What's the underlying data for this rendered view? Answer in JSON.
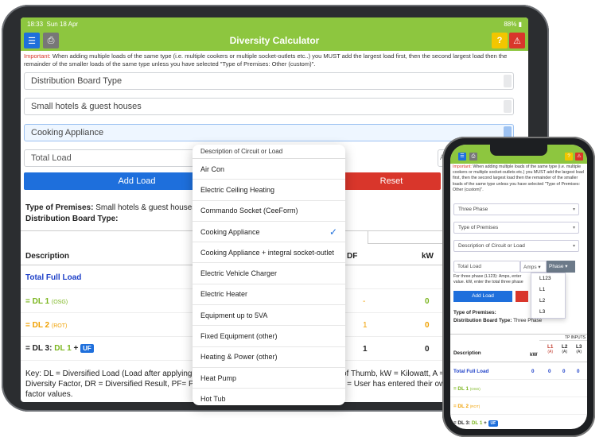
{
  "tablet": {
    "status": {
      "time": "18:33",
      "date": "Sun 18 Apr",
      "battery": "88%"
    },
    "header": {
      "title": "Diversity Calculator"
    },
    "notice": {
      "label": "Important:",
      "text": "When adding multiple loads of the same type (i.e. multiple cookers or multiple socket-outlets etc..) you MUST add the largest load first, then the second largest load then the remainder of the smaller loads of the same type unless you have selected \"Type of Premises: Other (custom)\"."
    },
    "selects": [
      "Distribution Board Type",
      "Small hotels & guest houses",
      "Cooking Appliance"
    ],
    "total_placeholder": "Total Load",
    "add_label": "Add Load",
    "reset_label": "Reset",
    "premises_label": "Type of Premises:",
    "premises_value": "Small hotels & guest houses",
    "db_type_label": "Distribution Board Type:",
    "table": {
      "group_header": "DR RE",
      "col_desc": "Description",
      "col_df": "DF",
      "col_kw": "kW",
      "rows": [
        {
          "label": "Total Full Load",
          "df": "",
          "kw": ""
        },
        {
          "label": "= DL 1",
          "tag": "(OSG)",
          "df": "-",
          "kw": "0"
        },
        {
          "label": "= DL 2",
          "tag": "(ROT)",
          "df": "1",
          "kw": "0"
        },
        {
          "label": "= DL 3:",
          "dl": "DL 1",
          "plus": "+",
          "uf": "UF",
          "df": "1",
          "kw": "0"
        }
      ]
    },
    "key_text": "Key: DL = Diversified Load (Load after applying di",
    "key_text_right": "of Thumb, kW = Kilowatt, A =",
    "key_line2": "Diversity Factor, DR = Diversified Result, PF= Pow",
    "key_line2_right": ") = User has entered their own",
    "key_line3": "factor values."
  },
  "dropdown": {
    "header": "Description of Circuit or Load",
    "selected": "Cooking Appliance",
    "items": [
      "Air Con",
      "Electric Ceiling Heating",
      "Commando Socket (CeeForm)",
      "Cooking Appliance",
      "Cooking Appliance + integral socket-outlet",
      "Electric Vehicle Charger",
      "Electric Heater",
      "Equipment up to 5VA",
      "Fixed Equipment (other)",
      "Heating & Power (other)",
      "Heat Pump",
      "Hot Tub"
    ]
  },
  "phone": {
    "notice": {
      "label": "Important:",
      "text": "When adding multiple loads of the same type (i.e. multiple cookers or multiple socket-outlets etc.) you MUST add the largest load first, then the second largest load then the remainder of the smaller loads of the same type unless you have selected \"Type of Premises: Other (custom)\"."
    },
    "selects": [
      "Three Phase",
      "Type of Premises",
      "Description of Circuit or Load"
    ],
    "total_placeholder": "Total Load",
    "amps_label": "Amps",
    "phase_label": "Phase",
    "hint": "For three phase (L123): Amps, enter value. kW, enter the total three phase",
    "phase_options": [
      "L123",
      "L1",
      "L2",
      "L3"
    ],
    "add_label": "Add Load",
    "premises_label": "Type of Premises:",
    "db_type_label": "Distribution Board Type:",
    "db_type_value": "Three Phase",
    "table": {
      "group_header": "TP INPUTS",
      "col_desc": "Description",
      "col_kw": "kW",
      "col_l1": "L1",
      "col_l1_unit": "(A)",
      "col_l2": "L2",
      "col_l2_unit": "(A)",
      "col_l3": "L3",
      "col_l3_unit": "(A)",
      "rows": [
        {
          "label": "Total Full Load",
          "vals": [
            "0",
            "0",
            "0",
            "0"
          ]
        },
        {
          "label": "= DL 1",
          "tag": "(OSG)"
        },
        {
          "label": "= DL 2",
          "tag": "(ROT)"
        },
        {
          "label": "= DL 3:",
          "dl": "DL 1",
          "plus": "+",
          "uf": "UF"
        }
      ]
    }
  },
  "colors": {
    "brand_green": "#8dc63f",
    "primary_blue": "#1e6fdc",
    "danger_red": "#d9362b",
    "dl1_green": "#7ab51d",
    "dl2_orange": "#f0a000"
  }
}
